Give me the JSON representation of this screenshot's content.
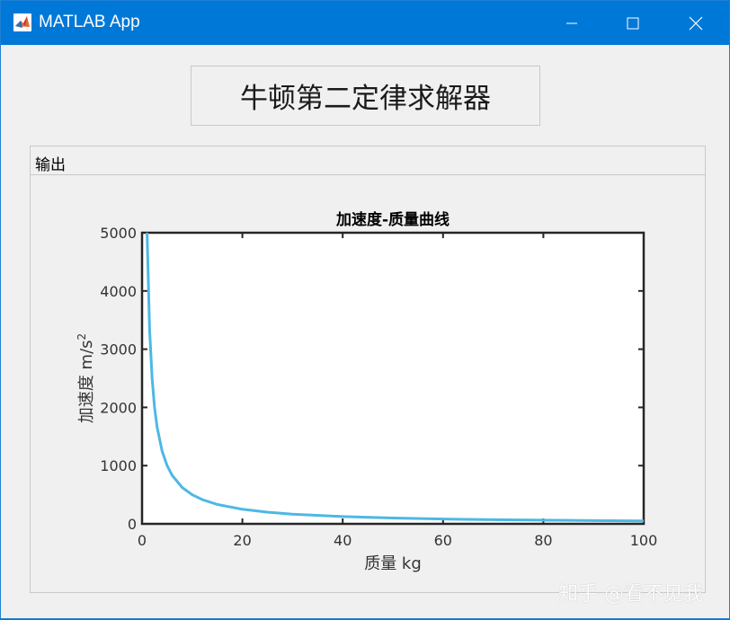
{
  "window": {
    "title": "MATLAB App",
    "minimize_label": "—",
    "maximize_label": "☐",
    "close_label": "✕"
  },
  "header": {
    "title": "牛顿第二定律求解器"
  },
  "panel": {
    "title": "输出"
  },
  "chart_data": {
    "type": "line",
    "title": "加速度-质量曲线",
    "xlabel": "质量 kg",
    "ylabel": "加速度  m/s",
    "ylabel_superscript": "2",
    "xlim": [
      0,
      100
    ],
    "ylim": [
      0,
      5000
    ],
    "x_ticks": [
      0,
      20,
      40,
      60,
      80,
      100
    ],
    "y_ticks": [
      0,
      1000,
      2000,
      3000,
      4000,
      5000
    ],
    "grid": false,
    "series": [
      {
        "color": "#4db8e5",
        "x": [
          1,
          1.5,
          2,
          2.5,
          3,
          4,
          5,
          6,
          8,
          10,
          12,
          15,
          20,
          25,
          30,
          40,
          50,
          60,
          70,
          80,
          90,
          100
        ],
        "values": [
          5000,
          3333,
          2500,
          2000,
          1667,
          1250,
          1000,
          833,
          625,
          500,
          417,
          333,
          250,
          200,
          167,
          125,
          100,
          83,
          71,
          63,
          56,
          50
        ]
      }
    ]
  },
  "watermark": "知乎 @看不见我"
}
